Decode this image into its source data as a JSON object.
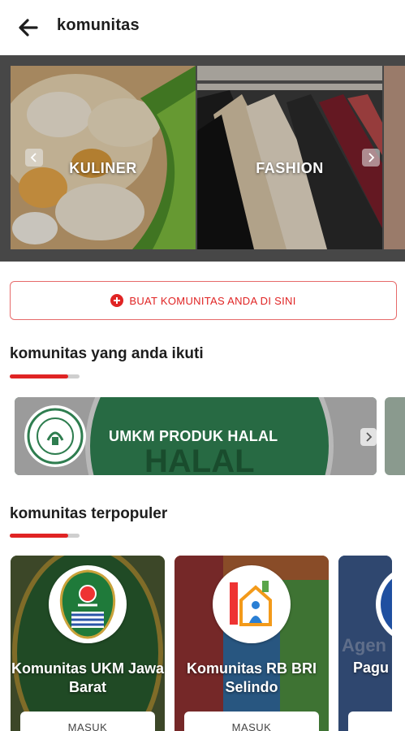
{
  "header": {
    "title": "komunitas",
    "back_icon": "arrow-left-icon"
  },
  "categories": [
    {
      "label": "KULINER"
    },
    {
      "label": "FASHION"
    }
  ],
  "create_button": {
    "label": "BUAT KOMUNITAS ANDA DI SINI",
    "icon": "plus-circle-icon",
    "color": "#e02424"
  },
  "joined_section": {
    "title": "komunitas yang anda ikuti",
    "items": [
      {
        "name": "UMKM PRODUK HALAL"
      }
    ]
  },
  "popular_section": {
    "title": "komunitas terpopuler",
    "items": [
      {
        "name": "Komunitas UKM Jawa Barat",
        "button": "MASUK"
      },
      {
        "name": "Komunitas RB BRI Selindo",
        "button": "MASUK"
      },
      {
        "name": "Pagu",
        "button": "MASUK"
      }
    ]
  },
  "colors": {
    "accent": "#e02424",
    "strip_bg": "#474747"
  }
}
